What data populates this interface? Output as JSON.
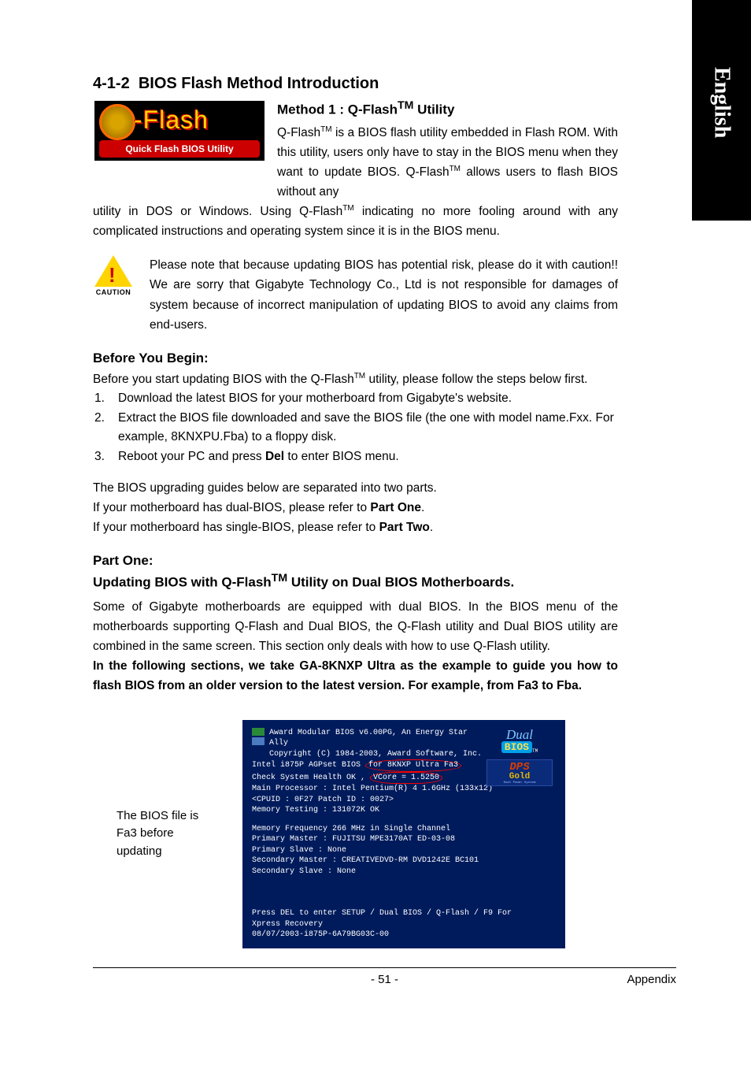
{
  "sideTab": "English",
  "sectionNumber": "4-1-2",
  "sectionTitle": "BIOS Flash Method Introduction",
  "qflashLogo": {
    "main": "-Flash",
    "bar": "Quick Flash BIOS Utility"
  },
  "method1": {
    "title_pre": "Method 1 : Q-Flash",
    "title_tm": "TM",
    "title_post": " Utility",
    "para_a": "Q-Flash",
    "para_b": " is a BIOS flash utility embedded in Flash ROM. With this utility, users only have to stay in the BIOS menu when they want to update BIOS. Q-Flash",
    "para_c": " allows users to flash BIOS without any",
    "para_d": "utility in DOS or Windows. Using Q-Flash",
    "para_e": " indicating no more fooling around with any complicated instructions and operating system since it is in the BIOS menu."
  },
  "cautionLabel": "CAUTION",
  "cautionText": "Please note that because updating BIOS has potential risk, please do it with caution!! We are sorry that Gigabyte Technology Co., Ltd is not responsible for damages of system because of incorrect manipulation of updating BIOS to avoid any claims from end-users.",
  "beforeBegin": {
    "heading": "Before You Begin:",
    "intro_a": "Before you start updating BIOS with the Q-Flash",
    "intro_b": " utility, please follow the steps below first.",
    "steps": [
      "Download the latest BIOS for your motherboard from Gigabyte's website.",
      "Extract the BIOS file downloaded and save the BIOS file (the one with model name.Fxx. For example,  8KNXPU.Fba) to a floppy disk.",
      "Reboot your PC and press Del to enter BIOS menu."
    ],
    "note1": "The BIOS upgrading guides below are separated into two parts.",
    "note2a": "If your motherboard has dual-BIOS, please refer to ",
    "note2b": "Part One",
    "note3a": "If your motherboard has single-BIOS, please refer to ",
    "note3b": "Part Two"
  },
  "partOne": {
    "heading": "Part One:",
    "sub_a": "Updating BIOS with Q-Flash",
    "sub_b": " Utility on Dual BIOS Motherboards.",
    "para": "Some of Gigabyte motherboards are equipped with dual BIOS. In the BIOS menu of the motherboards supporting Q-Flash and Dual BIOS, the Q-Flash utility and Dual BIOS utility are combined in the same screen. This section only deals with how to use Q-Flash utility.",
    "bold": "In the following sections, we take GA-8KNXP Ultra as the example to guide you how to flash BIOS from an older version to the latest version. For example, from Fa3 to Fba."
  },
  "annot": "The BIOS file is Fa3 before updating",
  "bios": {
    "l1": "Award Modular BIOS v6.00PG, An Energy Star",
    "l2": "Ally",
    "l3": "Copyright (C) 1984-2003, Award Software, Inc.",
    "l4a": "Intel i875P AGPset BIOS ",
    "l4b": "for 8KNXP Ultra Fa3",
    "l5a": "Check System Health OK , ",
    "l5b": "VCore = 1.5250",
    "l6": "Main Processor : Intel Pentium(R) 4  1.6GHz (133x12)",
    "l7": "<CPUID : 0F27 Patch ID  : 0027>",
    "l8": "Memory Testing  : 131072K OK",
    "l9": "Memory Frequency 266 MHz in Single Channel",
    "l10": "Primary Master : FUJITSU MPE3170AT ED-03-08",
    "l11": "Primary Slave : None",
    "l12": "Secondary Master : CREATIVEDVD-RM DVD1242E BC101",
    "l13": "Secondary Slave : None",
    "l14": "Press DEL to enter SETUP / Dual BIOS / Q-Flash / F9 For",
    "l15": "Xpress Recovery",
    "l16": "08/07/2003-i875P-6A79BG03C-00",
    "dualLogo": {
      "dual": "Dual",
      "bios": "BIOS",
      "tm": "TM"
    },
    "dpsLogo": {
      "dps": "DPS",
      "gold": "Gold",
      "sub": "Dual Power System"
    }
  },
  "footer": {
    "page": "- 51 -",
    "section": "Appendix"
  }
}
